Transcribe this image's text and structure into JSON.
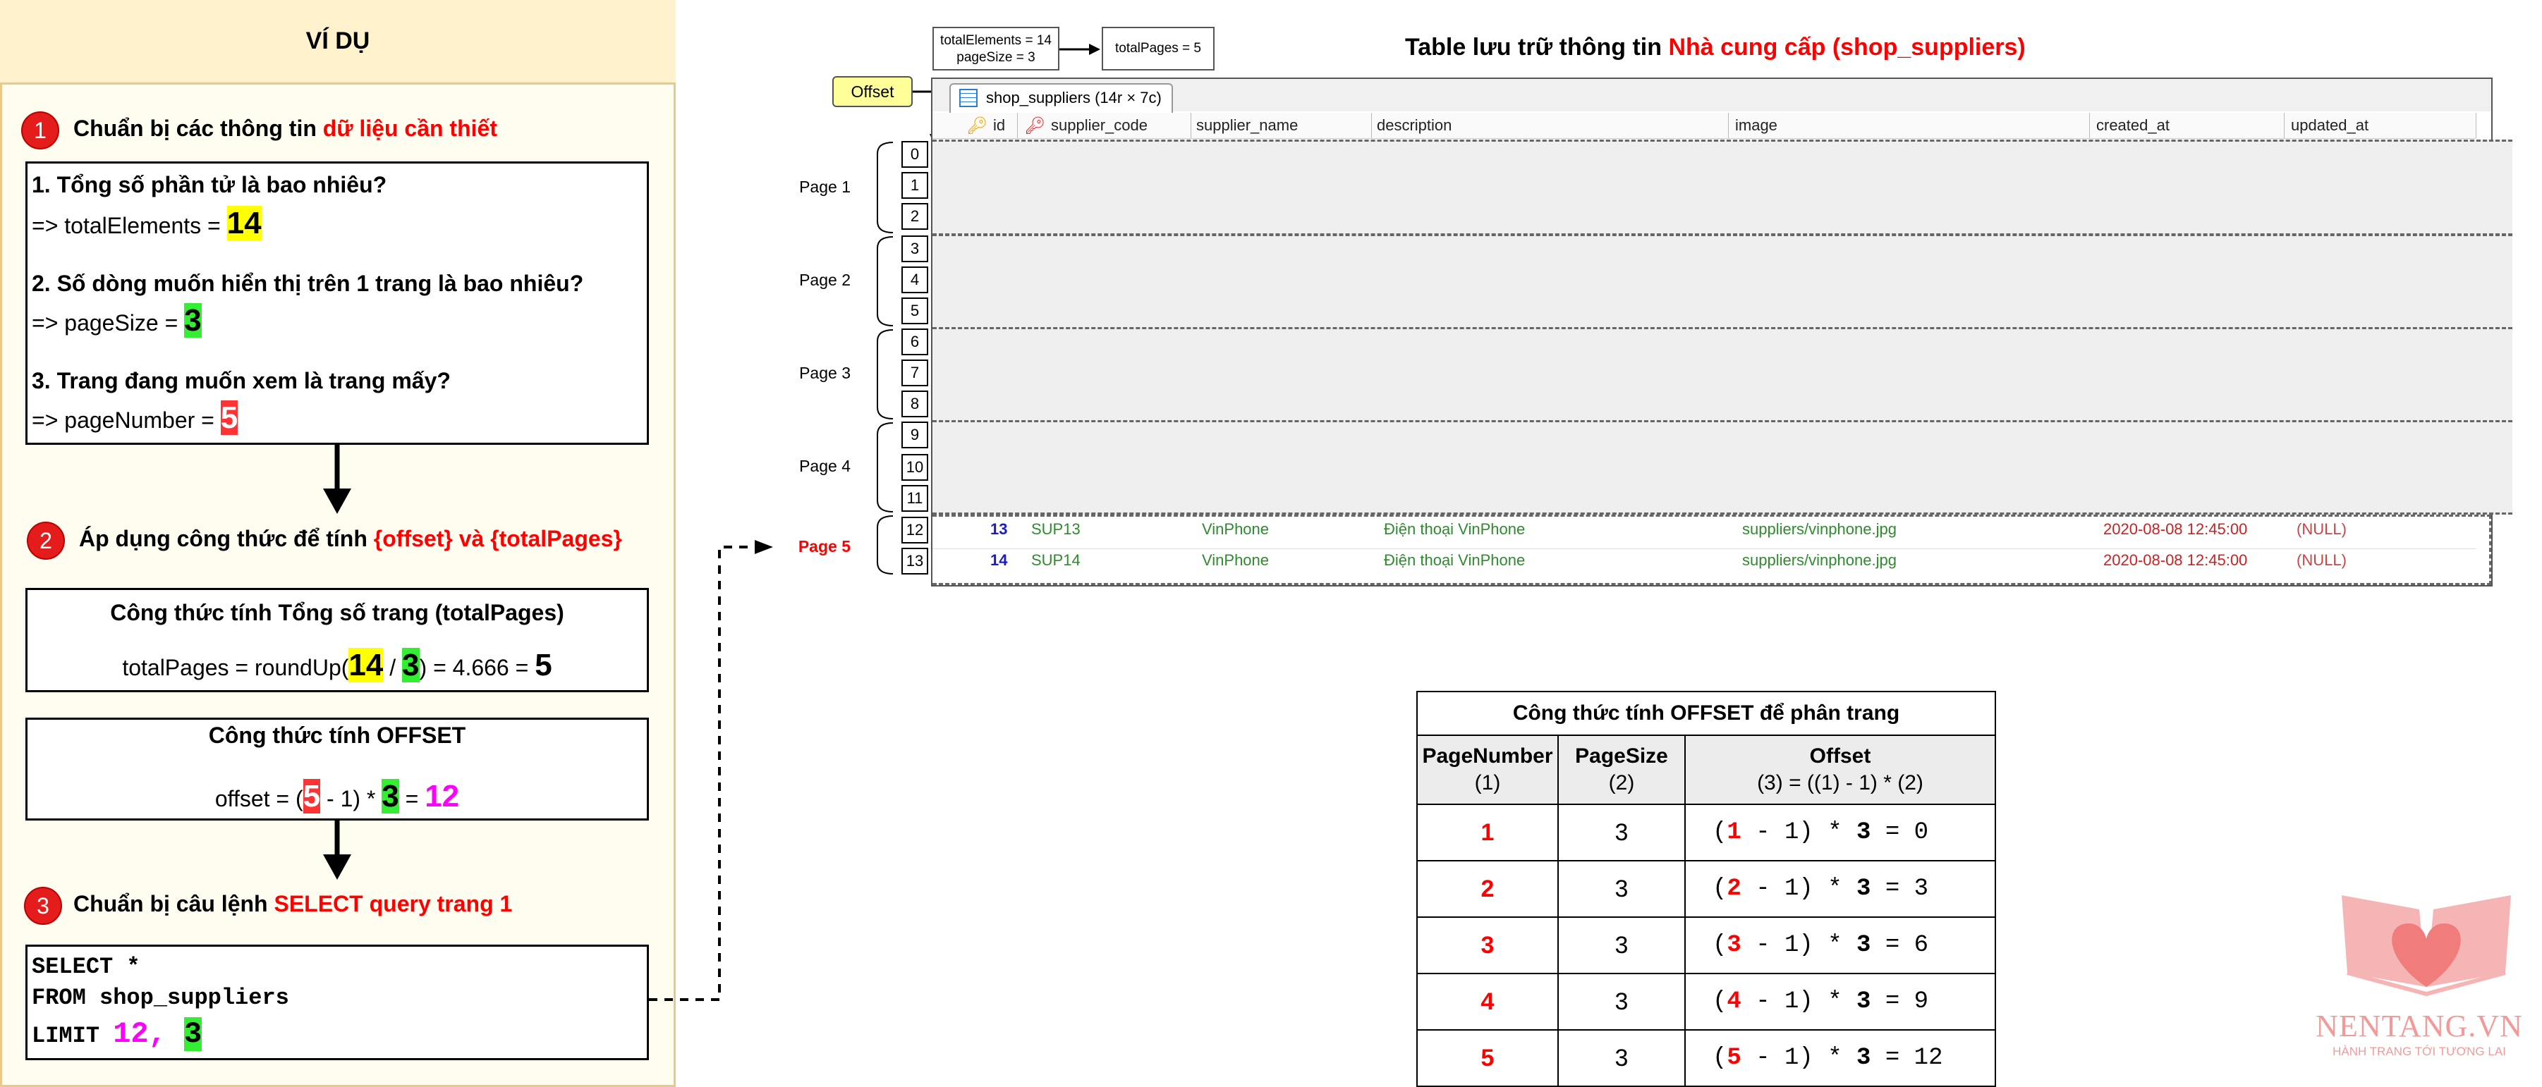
{
  "panel": {
    "title": "VÍ DỤ",
    "step1": {
      "num": "1",
      "text": "Chuẩn bị các thông tin ",
      "highlight": "dữ liệu cần thiết",
      "q1": "1. Tổng số phần tử là bao nhiêu?",
      "a1_prefix": "=> totalElements = ",
      "a1_value": "14",
      "q2": "2. Số dòng muốn hiển thị trên 1 trang là bao nhiêu?",
      "a2_prefix": "=> pageSize = ",
      "a2_value": "3",
      "q3": "3. Trang đang muốn xem là trang mấy?",
      "a3_prefix": "=> pageNumber = ",
      "a3_value": "5"
    },
    "step2": {
      "num": "2",
      "text": "Áp dụng công thức để tính ",
      "highlight": "{offset} và {totalPages}",
      "box1_title": "Công thức tính Tổng số trang (totalPages)",
      "box1_prefix": "totalPages = roundUp(",
      "box1_a": "14",
      "box1_div": " / ",
      "box1_b": "3",
      "box1_mid": ") = 4.666 = ",
      "box1_result": "5",
      "box2_title": "Công thức tính OFFSET",
      "box2_prefix": "offset = (",
      "box2_a": "5",
      "box2_mid": " - 1) * ",
      "box2_b": "3",
      "box2_eq": " = ",
      "box2_result": "12"
    },
    "step3": {
      "num": "3",
      "text": "Chuẩn bị câu lệnh ",
      "highlight": "SELECT query trang 1",
      "sql_line1": "SELECT *",
      "sql_line2": "FROM shop_suppliers",
      "sql_line3_prefix": "LIMIT ",
      "sql_offset": "12, ",
      "sql_size": "3"
    }
  },
  "notes": {
    "elements_line1": "totalElements = 14",
    "elements_line2": "pageSize = 3",
    "pages": "totalPages = 5",
    "offset": "Offset"
  },
  "table_title": {
    "prefix": "Table lưu trữ thông tin ",
    "highlight": "Nhà cung cấp (shop_suppliers)"
  },
  "grid": {
    "tab_label": "shop_suppliers (14r × 7c)",
    "columns": [
      "id",
      "supplier_code",
      "supplier_name",
      "description",
      "image",
      "created_at",
      "updated_at"
    ],
    "row_indices": [
      "0",
      "1",
      "2",
      "3",
      "4",
      "5",
      "6",
      "7",
      "8",
      "9",
      "10",
      "11",
      "12",
      "13"
    ],
    "pages": [
      "Page 1",
      "Page 2",
      "Page 3",
      "Page 4",
      "Page 5"
    ],
    "rows": [
      {
        "id": "13",
        "supplier_code": "SUP13",
        "supplier_name": "VinPhone",
        "description": "Điện thoại VinPhone",
        "image": "suppliers/vinphone.jpg",
        "created_at": "2020-08-08 12:45:00",
        "updated_at": "(NULL)"
      },
      {
        "id": "14",
        "supplier_code": "SUP14",
        "supplier_name": "VinPhone",
        "description": "Điện thoại VinPhone",
        "image": "suppliers/vinphone.jpg",
        "created_at": "2020-08-08 12:45:00",
        "updated_at": "(NULL)"
      }
    ]
  },
  "offset_table": {
    "title": "Công thức tính OFFSET để phân trang",
    "h1_line1": "PageNumber",
    "h1_line2": "(1)",
    "h2_line1": "PageSize",
    "h2_line2": "(2)",
    "h3_line1": "Offset",
    "h3_line2": "(3) = ((1) - 1) * (2)",
    "rows": [
      {
        "page": "1",
        "size": "3",
        "f_open": "(",
        "f_mid": " - 1) * ",
        "f_size": "3",
        "f_res": " = 0"
      },
      {
        "page": "2",
        "size": "3",
        "f_open": "(",
        "f_mid": " - 1) * ",
        "f_size": "3",
        "f_res": " = 3"
      },
      {
        "page": "3",
        "size": "3",
        "f_open": "(",
        "f_mid": " - 1) * ",
        "f_size": "3",
        "f_res": " = 6"
      },
      {
        "page": "4",
        "size": "3",
        "f_open": "(",
        "f_mid": " - 1) * ",
        "f_size": "3",
        "f_res": " = 9"
      },
      {
        "page": "5",
        "size": "3",
        "f_open": "(",
        "f_mid": " - 1) * ",
        "f_size": "3",
        "f_res": " = 12"
      }
    ]
  },
  "logo": {
    "name": "NENTANG.VN",
    "tagline": "HÀNH TRANG TỚI TƯƠNG LAI"
  },
  "colors": {
    "accent_red": "#ff0000",
    "highlight_yellow": "#ffff00",
    "highlight_green": "#33ee33",
    "highlight_magenta": "#ff00ff",
    "panel_bg": "#fffdf0",
    "logo_pink": "#f29a9a"
  }
}
